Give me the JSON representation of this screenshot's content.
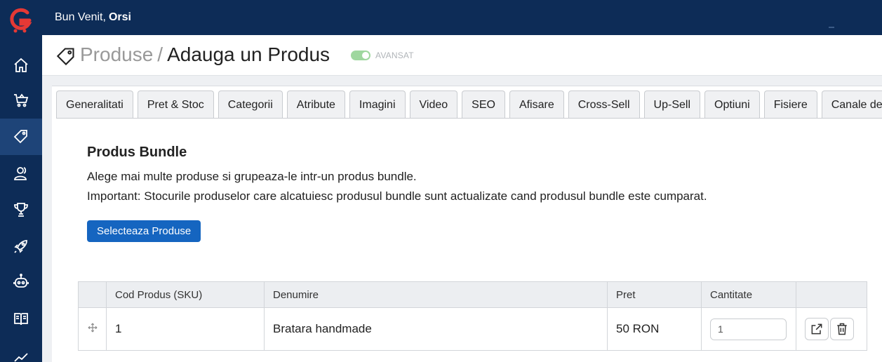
{
  "topbar": {
    "greeting": "Bun Venit,",
    "user": "Orsi"
  },
  "header": {
    "crumb": "Produse",
    "separator": "/",
    "page": "Adauga un Produs",
    "toggle_label": "AVANSAT"
  },
  "tabs": [
    "Generalitati",
    "Pret & Stoc",
    "Categorii",
    "Atribute",
    "Imagini",
    "Video",
    "SEO",
    "Afisare",
    "Cross-Sell",
    "Up-Sell",
    "Optiuni",
    "Fisiere",
    "Canale de V"
  ],
  "section": {
    "title": "Produs Bundle",
    "line1": "Alege mai multe produse si grupeaza-le intr-un produs bundle.",
    "line2": "Important: Stocurile produselor care alcatuiesc produsul bundle sunt actualizate cand produsul bundle este cumparat.",
    "button": "Selecteaza Produse"
  },
  "table": {
    "headers": [
      "",
      "Cod Produs (SKU)",
      "Denumire",
      "Pret",
      "Cantitate",
      ""
    ],
    "rows": [
      {
        "sku": "1",
        "name": "Bratara handmade",
        "price": "50 RON",
        "qty": "1"
      }
    ]
  },
  "colors": {
    "sidebar": "#0d2c57",
    "accent": "#1565c0",
    "toggle": "#9fd79f",
    "logo": "#e53935"
  },
  "icons": [
    "home-icon",
    "cart-icon",
    "tag-icon",
    "users-icon",
    "trophy-icon",
    "rocket-icon",
    "robot-icon",
    "book-icon",
    "chart-icon",
    "move-icon",
    "share-icon",
    "trash-icon"
  ]
}
